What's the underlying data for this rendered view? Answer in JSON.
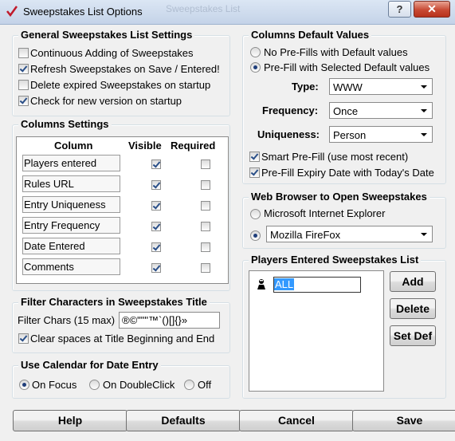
{
  "window": {
    "title": "Sweepstakes List Options",
    "background_title": "Sweepstakes List",
    "help_label": "?",
    "close_label": "✕"
  },
  "general": {
    "title": "General Sweepstakes List Settings",
    "options": [
      {
        "label": "Continuous Adding of Sweepstakes",
        "checked": false
      },
      {
        "label": "Refresh Sweepstakes on Save / Entered!",
        "checked": true
      },
      {
        "label": "Delete expired Sweepstakes on startup",
        "checked": false
      },
      {
        "label": "Check for new version on startup",
        "checked": true
      }
    ]
  },
  "columns": {
    "title": "Columns Settings",
    "headers": [
      "Column",
      "Visible",
      "Required"
    ],
    "rows": [
      {
        "name": "Players entered",
        "visible": true,
        "required": false
      },
      {
        "name": "Rules URL",
        "visible": true,
        "required": false
      },
      {
        "name": "Entry Uniqueness",
        "visible": true,
        "required": false
      },
      {
        "name": "Entry Frequency",
        "visible": true,
        "required": false
      },
      {
        "name": "Date Entered",
        "visible": true,
        "required": false
      },
      {
        "name": "Comments",
        "visible": true,
        "required": false
      }
    ]
  },
  "filter": {
    "title": "Filter Characters in Sweepstakes Title",
    "label": "Filter Chars (15 max)",
    "value": "®©\"\"\"™`()[]{}»",
    "clear_spaces_label": "Clear spaces at Title Beginning and End",
    "clear_spaces_checked": true
  },
  "calendar": {
    "title": "Use Calendar for Date Entry",
    "options": [
      {
        "label": "On Focus",
        "selected": true
      },
      {
        "label": "On DoubleClick",
        "selected": false
      },
      {
        "label": "Off",
        "selected": false
      }
    ]
  },
  "defaults": {
    "title": "Columns Default Values",
    "radio_no_prefill": "No Pre-Fills with Default values",
    "radio_prefill": "Pre-Fill with Selected Default values",
    "prefill_selected": true,
    "type_label": "Type:",
    "type_value": "WWW",
    "frequency_label": "Frequency:",
    "frequency_value": "Once",
    "uniqueness_label": "Uniqueness:",
    "uniqueness_value": "Person",
    "smart_prefill": "Smart Pre-Fill (use most recent)",
    "smart_prefill_checked": true,
    "expiry_prefill": "Pre-Fill Expiry Date with Today's Date",
    "expiry_prefill_checked": true
  },
  "browser": {
    "title": "Web Browser to Open Sweepstakes",
    "option_ie": "Microsoft Internet Explorer",
    "option_other_value": "Mozilla FireFox",
    "ie_selected": false
  },
  "players": {
    "title": "Players Entered Sweepstakes List",
    "items": [
      "ALL"
    ],
    "add_label": "Add",
    "delete_label": "Delete",
    "setdef_label": "Set Def"
  },
  "buttons": {
    "help": "Help",
    "defaults": "Defaults",
    "cancel": "Cancel",
    "save": "Save"
  },
  "colors": {
    "selection": "#3399ff",
    "close_button": "#c84a34"
  }
}
